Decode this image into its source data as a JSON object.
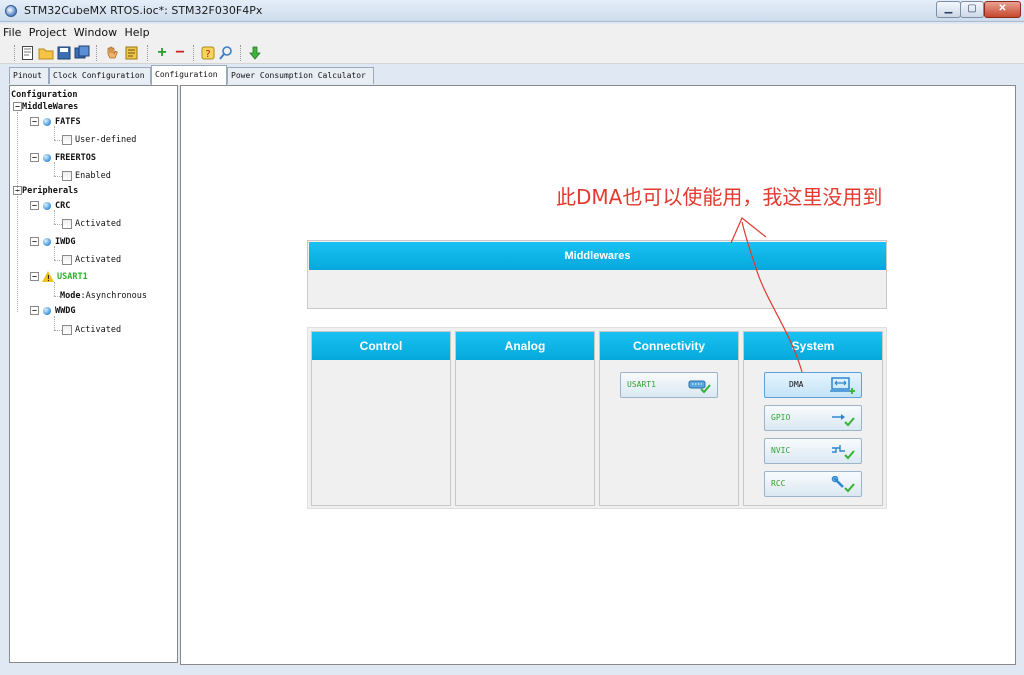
{
  "window": {
    "title": "STM32CubeMX RTOS.ioc*: STM32F030F4Px",
    "minimize_label": "▁",
    "maximize_label": "▢",
    "close_label": "✕"
  },
  "menu": {
    "items": [
      "File",
      "Project",
      "Window",
      "Help"
    ]
  },
  "toolbar": {
    "icons": [
      "new-project-icon",
      "open-folder-icon",
      "save-icon",
      "save-as-icon",
      "hand-icon",
      "generate-report-icon",
      "add-icon",
      "remove-icon",
      "help-icon",
      "search-icon",
      "download-icon"
    ]
  },
  "tabs": [
    {
      "label": "Pinout"
    },
    {
      "label": "Clock Configuration"
    },
    {
      "label": "Configuration"
    },
    {
      "label": "Power Consumption Calculator"
    }
  ],
  "tree": {
    "root": "Configuration",
    "middlewares_label": "MiddleWares",
    "fatfs": {
      "label": "FATFS",
      "option": "User-defined"
    },
    "freertos": {
      "label": "FREERTOS",
      "option": "Enabled"
    },
    "peripherals_label": "Peripherals",
    "crc": {
      "label": "CRC",
      "option": "Activated"
    },
    "iwdg": {
      "label": "IWDG",
      "option": "Activated"
    },
    "usart1": {
      "label": "USART1",
      "mode_label": "Mode",
      "mode_value": "Asynchronous"
    },
    "wwdg": {
      "label": "WWDG",
      "option": "Activated"
    }
  },
  "canvas": {
    "middlewares_header": "Middlewares",
    "groups": [
      {
        "title": "Control"
      },
      {
        "title": "Analog"
      },
      {
        "title": "Connectivity"
      },
      {
        "title": "System"
      }
    ],
    "connectivity_buttons": [
      {
        "label": "USART1"
      }
    ],
    "system_buttons": [
      {
        "label": "DMA"
      },
      {
        "label": "GPIO"
      },
      {
        "label": "NVIC"
      },
      {
        "label": "RCC"
      }
    ]
  },
  "annotation": {
    "text": "此DMA也可以使能用，我这里没用到",
    "color": "#e23a2f"
  },
  "colors": {
    "header_blue": "#0fb4e8",
    "ok_green": "#2ea52e",
    "warn_yellow": "#f1c21a"
  }
}
